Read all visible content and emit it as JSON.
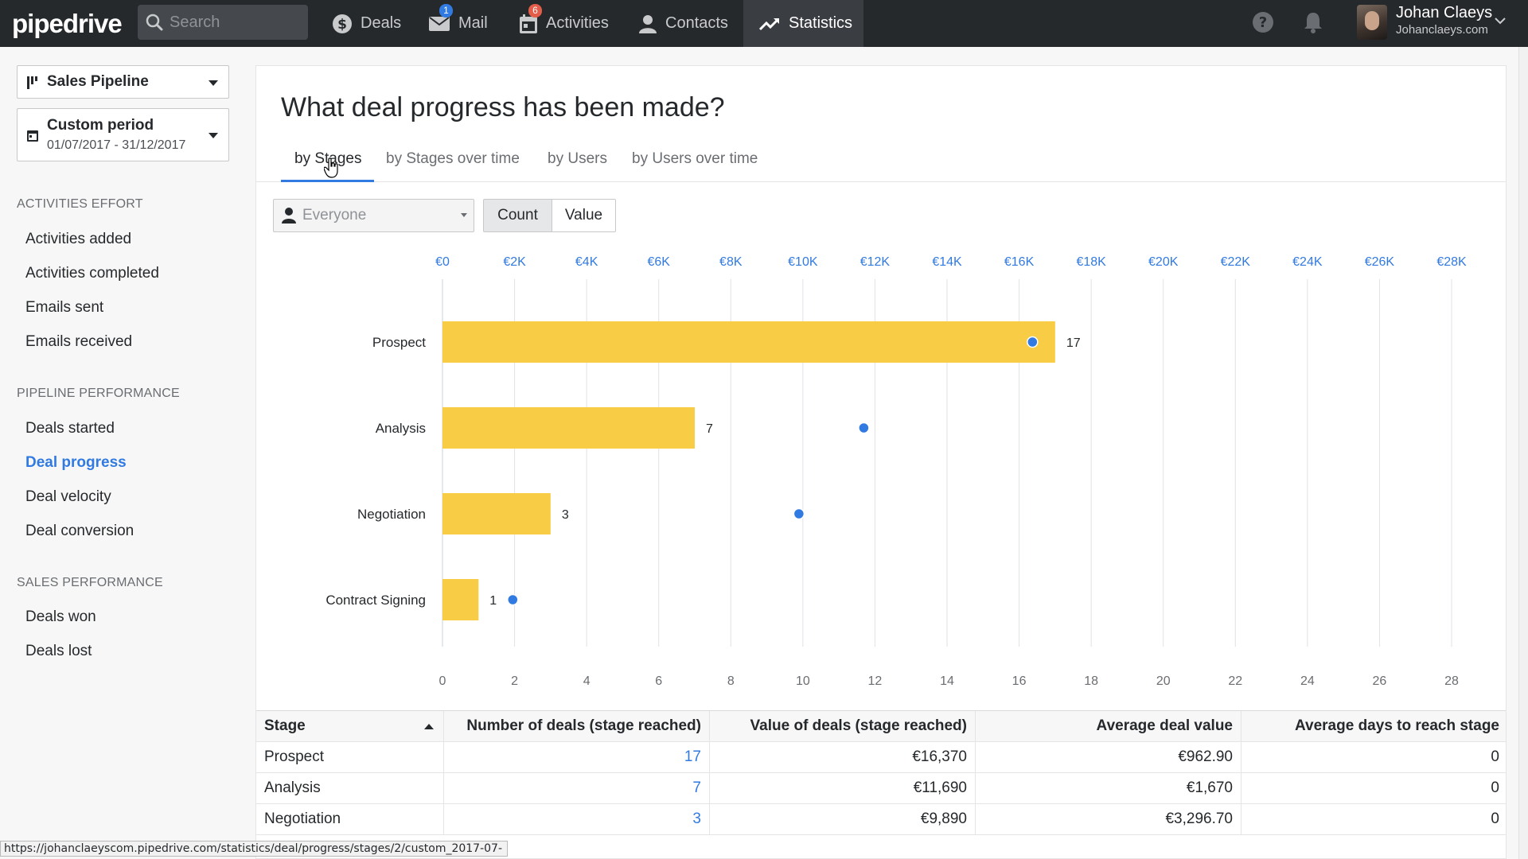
{
  "app": {
    "logo": "pipedrive"
  },
  "search": {
    "placeholder": "Search"
  },
  "nav": [
    {
      "label": "Deals",
      "icon": "dollar-icon",
      "badge": ""
    },
    {
      "label": "Mail",
      "icon": "mail-icon",
      "badge": "1"
    },
    {
      "label": "Activities",
      "icon": "calendar-icon",
      "badge": "6"
    },
    {
      "label": "Contacts",
      "icon": "person-icon",
      "badge": ""
    },
    {
      "label": "Statistics",
      "icon": "trending-icon",
      "badge": ""
    }
  ],
  "user": {
    "name": "Johan Claeys",
    "domain": "Johanclaeys.com"
  },
  "sidebar": {
    "pipeline": "Sales Pipeline",
    "period_title": "Custom period",
    "period_range": "01/07/2017 - 31/12/2017",
    "sections": [
      {
        "heading": "ACTIVITIES EFFORT",
        "items": [
          "Activities added",
          "Activities completed",
          "Emails sent",
          "Emails received"
        ]
      },
      {
        "heading": "PIPELINE PERFORMANCE",
        "items": [
          "Deals started",
          "Deal progress",
          "Deal velocity",
          "Deal conversion"
        ]
      },
      {
        "heading": "SALES PERFORMANCE",
        "items": [
          "Deals won",
          "Deals lost"
        ]
      }
    ],
    "active_item": "Deal progress"
  },
  "main": {
    "title": "What deal progress has been made?",
    "tabs": [
      "by Stages",
      "by Stages over time",
      "by Users",
      "by Users over time"
    ],
    "active_tab": "by Stages",
    "filter": {
      "person": "Everyone",
      "count_label": "Count",
      "value_label": "Value",
      "active": "Count"
    }
  },
  "chart_data": {
    "type": "bar",
    "orientation": "horizontal",
    "categories": [
      "Prospect",
      "Analysis",
      "Negotiation",
      "Contract Signing"
    ],
    "series": [
      {
        "values": [
          17,
          7,
          3,
          1
        ],
        "color": "#f9cc46",
        "axis": "bottom"
      },
      {
        "values": [
          16370,
          11690,
          9890,
          1950
        ],
        "color": "#317ae2",
        "axis": "top",
        "marker": "dot"
      }
    ],
    "x_ticks": [
      "0",
      "2",
      "4",
      "6",
      "8",
      "10",
      "12",
      "14",
      "16",
      "18",
      "20",
      "22",
      "24",
      "26",
      "28"
    ],
    "x_top_ticks": [
      "€0",
      "€2K",
      "€4K",
      "€6K",
      "€8K",
      "€10K",
      "€12K",
      "€14K",
      "€16K",
      "€18K",
      "€20K",
      "€22K",
      "€24K",
      "€26K",
      "€28K"
    ],
    "xlim": [
      0,
      28
    ],
    "x_top_lim": [
      0,
      28000
    ],
    "grid": true
  },
  "table": {
    "headers": [
      "Stage",
      "Number of deals (stage reached)",
      "Value of deals (stage reached)",
      "Average deal value",
      "Average days to reach stage"
    ],
    "rows": [
      [
        "Prospect",
        "17",
        "€16,370",
        "€962.90",
        "0"
      ],
      [
        "Analysis",
        "7",
        "€11,690",
        "€1,670",
        "0"
      ],
      [
        "Negotiation",
        "3",
        "€9,890",
        "€3,296.70",
        "0"
      ]
    ]
  },
  "status_url": "https://johanclaeyscom.pipedrive.com/statistics/deal/progress/stages/2/custom_2017-07-",
  "colors": {
    "accent": "#317ae2",
    "bar": "#f9cc46",
    "topbar": "#26292c"
  }
}
